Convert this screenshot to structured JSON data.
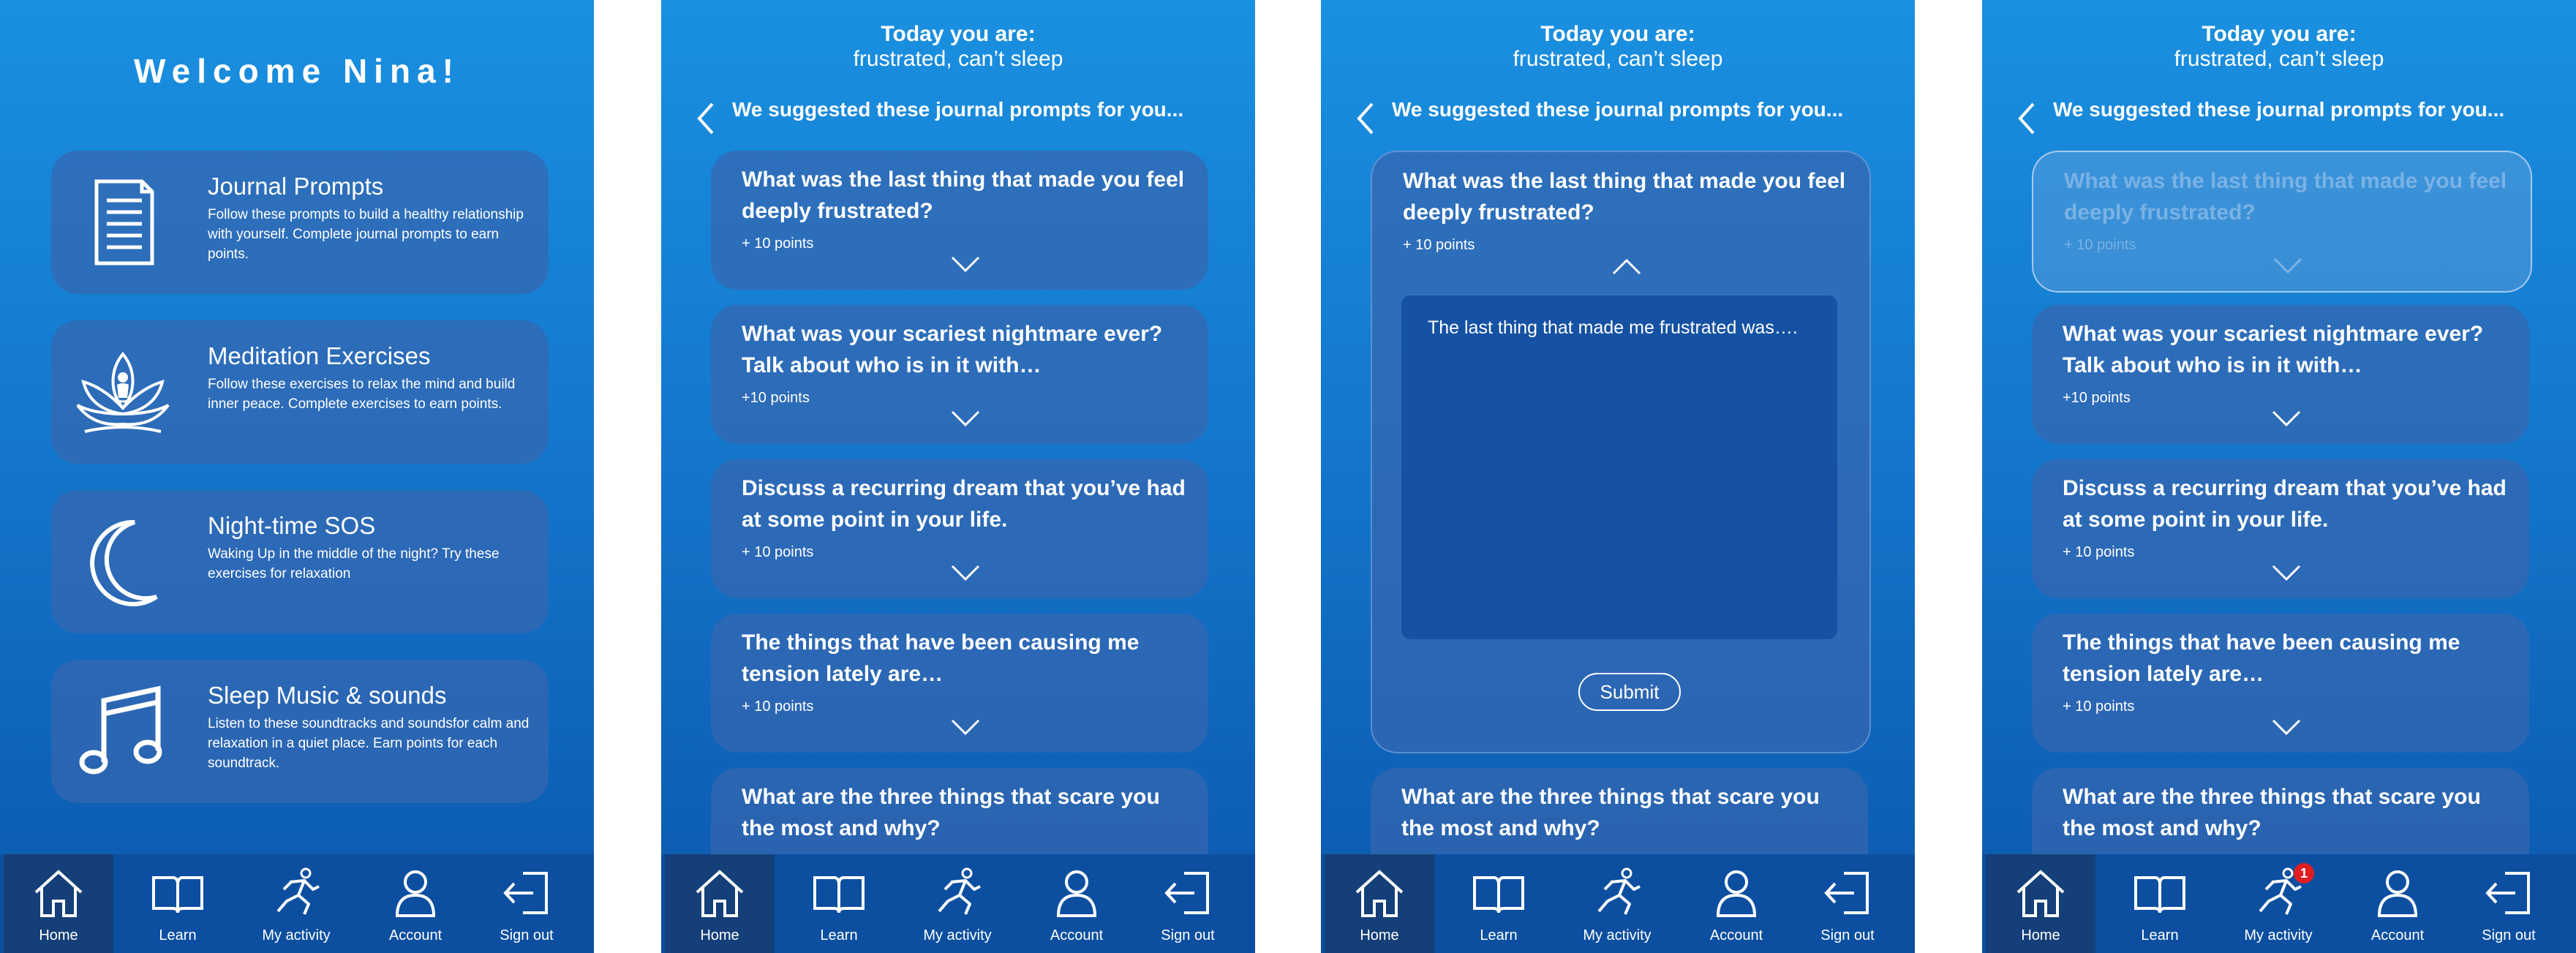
{
  "home": {
    "welcome": "Welcome Nina!",
    "cards": [
      {
        "icon": "journal-icon",
        "title": "Journal Prompts",
        "desc": "Follow these prompts to build a healthy relationship with yourself. Complete journal prompts to earn points."
      },
      {
        "icon": "lotus-meditation-icon",
        "title": "Meditation Exercises",
        "desc": "Follow these exercises to relax the mind and build inner peace. Complete exercises to earn points."
      },
      {
        "icon": "moon-icon",
        "title": "Night-time SOS",
        "desc": "Waking Up in the middle of the night? Try these exercises for relaxation"
      },
      {
        "icon": "music-note-icon",
        "title": "Sleep Music & sounds",
        "desc": "Listen to these soundtracks and soundsfor calm and relaxation in a quiet place. Earn points for each soundtrack."
      }
    ]
  },
  "prompts_page": {
    "today_label": "Today you are:",
    "mood": "frustrated, can’t sleep",
    "suggest_text": "We suggested these journal prompts for you...",
    "prompts": [
      {
        "text": "What was the last thing that made you feel deeply frustrated?",
        "points": "+ 10 points"
      },
      {
        "text": "What was your scariest nightmare ever? Talk about who is in it with…",
        "points": "+10 points"
      },
      {
        "text": "Discuss a recurring dream that you’ve had at some point in your life.",
        "points": "+ 10 points"
      },
      {
        "text": "The things that have been causing me tension lately are…",
        "points": "+ 10 points"
      },
      {
        "text": "What are the three things that scare you the most and why?",
        "points": ""
      }
    ],
    "answer_text": "The last thing that made me frustrated was….",
    "submit_label": "Submit"
  },
  "nav": [
    {
      "label": "Home",
      "icon": "home-icon"
    },
    {
      "label": "Learn",
      "icon": "book-icon"
    },
    {
      "label": "My activity",
      "icon": "running-person-icon"
    },
    {
      "label": "Account",
      "icon": "person-icon"
    },
    {
      "label": "Sign out",
      "icon": "sign-out-icon"
    }
  ],
  "activity_badge": "1",
  "colors": {
    "bg_top": "#1a90e0",
    "bg_bottom": "#0b57ad",
    "card": "#3667b0",
    "nav": "#0c4fa0",
    "nav_active": "#143f78",
    "badge": "#e11d22"
  }
}
